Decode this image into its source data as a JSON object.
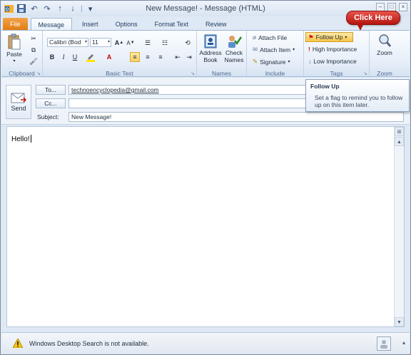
{
  "window": {
    "title": "New Message!  -  Message (HTML)"
  },
  "quick_access": {
    "icons": [
      "save-icon",
      "undo-icon",
      "redo-icon",
      "up-arrow-icon",
      "down-arrow-icon",
      "customize-icon"
    ]
  },
  "tabs": [
    {
      "label": "File"
    },
    {
      "label": "Message"
    },
    {
      "label": "Insert"
    },
    {
      "label": "Options"
    },
    {
      "label": "Format Text"
    },
    {
      "label": "Review"
    }
  ],
  "ribbon": {
    "clipboard": {
      "label": "Clipboard",
      "paste": "Paste"
    },
    "basic_text": {
      "label": "Basic Text",
      "font_name": "Calibri (Bod",
      "font_size": "11"
    },
    "names": {
      "label": "Names",
      "address_book_1": "Address",
      "address_book_2": "Book",
      "check_names_1": "Check",
      "check_names_2": "Names"
    },
    "include": {
      "label": "Include",
      "attach_file": "Attach File",
      "attach_item": "Attach Item",
      "signature": "Signature"
    },
    "tags": {
      "label": "Tags",
      "follow_up": "Follow Up",
      "high_importance": "High Importance",
      "low_importance": "Low Importance"
    },
    "zoom": {
      "label": "Zoom",
      "zoom": "Zoom"
    }
  },
  "callout": {
    "label": "Click Here"
  },
  "tooltip": {
    "title": "Follow Up",
    "description": "Set a flag to remind you to follow up on this item later."
  },
  "header": {
    "send": "Send",
    "to_button": "To...",
    "cc_button": "Cc...",
    "subject_label": "Subject:",
    "to_value": "technoencyclopedia@gmail.com",
    "cc_value": "",
    "subject_value": "New Message!"
  },
  "body": {
    "text": "Hello!"
  },
  "status": {
    "message": "Windows Desktop Search is not available."
  },
  "colors": {
    "file_tab": "#e27a0f",
    "callout": "#c41d17",
    "highlight": "#f8cf62"
  }
}
